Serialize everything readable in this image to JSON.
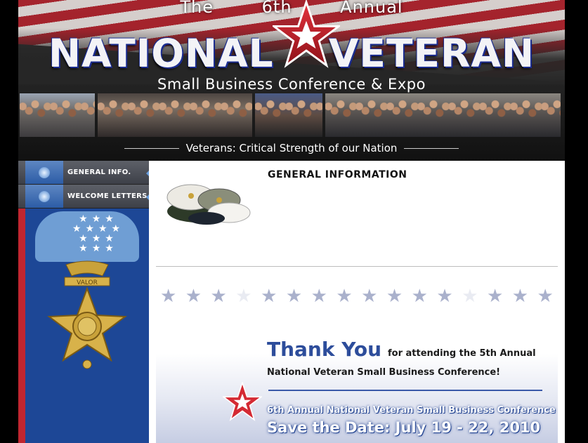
{
  "banner": {
    "top_line": "The 6th Annual",
    "title": "NATIONAL VETERAN",
    "subtitle": "Small Business Conference & Expo",
    "tagline": "Veterans: Critical Strength of our Nation"
  },
  "sidebar": {
    "items": [
      {
        "label": "GENERAL INFO."
      },
      {
        "label": "WELCOME LETTERS"
      }
    ],
    "medal_text": "VALOR"
  },
  "main": {
    "heading": "GENERAL INFORMATION",
    "promo": {
      "thank_you": "Thank You",
      "thank_side": "for attending the 5th Annual",
      "thank_line2": "National Veteran Small Business Conference!",
      "save_sub": "6th Annual National Veteran Small Business Conference",
      "save_date": "Save the Date: July 19 - 22, 2010"
    }
  },
  "colors": {
    "sidebar_blue": "#1d4796",
    "accent_red": "#c02630",
    "title_blue": "#2d4d9b"
  }
}
